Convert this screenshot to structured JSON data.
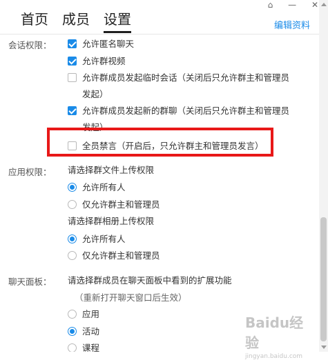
{
  "tabs": [
    {
      "label": "首页",
      "active": false
    },
    {
      "label": "成员",
      "active": false
    },
    {
      "label": "设置",
      "active": true
    }
  ],
  "header": {
    "edit_link": "编辑资料"
  },
  "window_controls": {
    "icon": "skin-icon",
    "minimize": "—",
    "close": "✕"
  },
  "sections": {
    "session": {
      "label": "会话权限：",
      "options": [
        {
          "label": "允许匿名聊天",
          "checked": true
        },
        {
          "label": "允许群视频",
          "checked": true
        },
        {
          "label": "允许群成员发起临时会话（关闭后只允许群主和管理员发起）",
          "checked": false
        },
        {
          "label": "允许群成员发起新的群聊（关闭后只允许群主和管理员发起）",
          "checked": true
        },
        {
          "label": "全员禁言（开启后，只允许群主和管理员发言）",
          "checked": false
        }
      ]
    },
    "app": {
      "label": "应用权限：",
      "file_upload_prompt": "请选择群文件上传权限",
      "file_upload_options": [
        {
          "label": "允许所有人",
          "selected": true
        },
        {
          "label": "仅允许群主和管理员",
          "selected": false
        }
      ],
      "album_upload_prompt": "请选择群相册上传权限",
      "album_upload_options": [
        {
          "label": "允许所有人",
          "selected": true
        },
        {
          "label": "仅允许群主和管理员",
          "selected": false
        }
      ]
    },
    "chat_panel": {
      "label": "聊天面板：",
      "prompt": "请选择群成员在聊天面板中看到的扩展功能",
      "hint": "（重新打开聊天窗口后生效）",
      "options": [
        {
          "label": "应用",
          "selected": false
        },
        {
          "label": "活动",
          "selected": true
        },
        {
          "label": "课程",
          "selected": false
        }
      ]
    }
  },
  "colors": {
    "accent": "#1a8be8",
    "highlight": "#e81818"
  },
  "watermark": {
    "main": "Baidu经验",
    "sub": "jingyan.baidu.com"
  }
}
